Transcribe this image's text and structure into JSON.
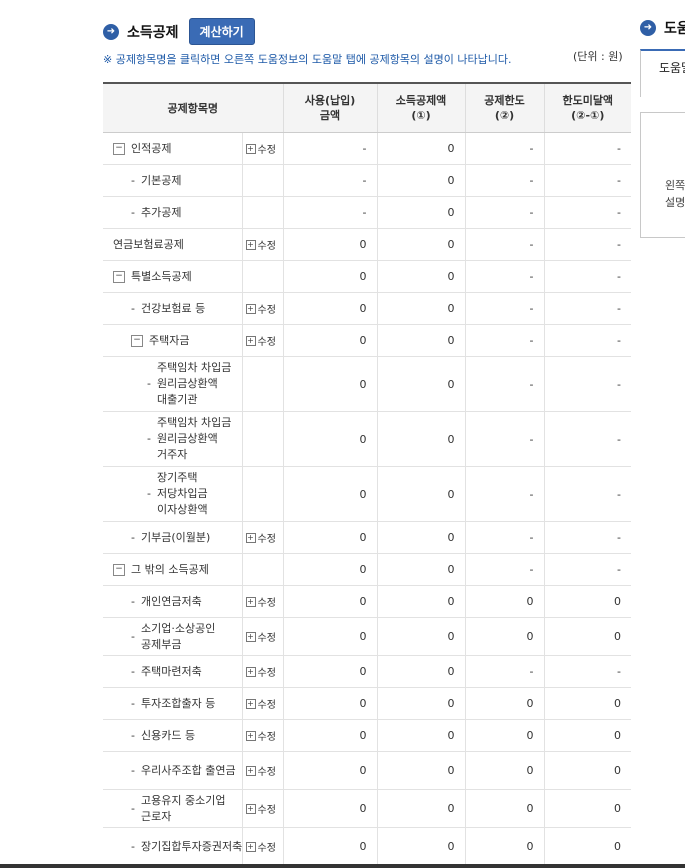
{
  "section": {
    "title": "소득공제",
    "calc_button": "계산하기"
  },
  "notice": "※ 공제항목명을 클릭하면 오른쪽 도움정보의 도움말 탭에 공제항목의 설명이 나타납니다.",
  "unit": "(단위 : 원)",
  "columns": [
    "공제항목명",
    "사용(납입)\n금액",
    "소득공제액\n(①)",
    "공제한도\n(②)",
    "한도미달액\n(②-①)"
  ],
  "edit_label": "수정",
  "rows": [
    {
      "name": "인적공제",
      "level": "lvl0",
      "toggle": "−",
      "edit": true,
      "amount": "-",
      "deduction": "0",
      "limit": "-",
      "shortfall": "-"
    },
    {
      "name": "기본공제",
      "level": "lvl1",
      "dash": "-",
      "edit": false,
      "amount": "-",
      "deduction": "0",
      "limit": "-",
      "shortfall": "-"
    },
    {
      "name": "추가공제",
      "level": "lvl1",
      "dash": "-",
      "edit": false,
      "amount": "-",
      "deduction": "0",
      "limit": "-",
      "shortfall": "-"
    },
    {
      "name": "연금보험료공제",
      "level": "lvl0plain",
      "edit": true,
      "amount": "0",
      "deduction": "0",
      "limit": "-",
      "shortfall": "-"
    },
    {
      "name": "특별소득공제",
      "level": "lvl0",
      "toggle": "−",
      "edit": false,
      "amount": "0",
      "deduction": "0",
      "limit": "-",
      "shortfall": "-"
    },
    {
      "name": "건강보험료 등",
      "level": "lvl1",
      "dash": "-",
      "edit": true,
      "amount": "0",
      "deduction": "0",
      "limit": "-",
      "shortfall": "-"
    },
    {
      "name": "주택자금",
      "level": "lvl1b",
      "toggle": "−",
      "edit": true,
      "amount": "0",
      "deduction": "0",
      "limit": "-",
      "shortfall": "-"
    },
    {
      "name": "주택임차 차입금 원리금상환액 대출기관",
      "level": "lvl2",
      "dash": "-",
      "edit": false,
      "tall": true,
      "amount": "0",
      "deduction": "0",
      "limit": "-",
      "shortfall": "-"
    },
    {
      "name": "주택임차 차입금 원리금상환액 거주자",
      "level": "lvl2",
      "dash": "-",
      "edit": false,
      "tall": true,
      "amount": "0",
      "deduction": "0",
      "limit": "-",
      "shortfall": "-"
    },
    {
      "name": "장기주택 저당차입금 이자상환액",
      "level": "lvl2",
      "dash": "-",
      "edit": false,
      "tall": true,
      "amount": "0",
      "deduction": "0",
      "limit": "-",
      "shortfall": "-"
    },
    {
      "name": "기부금(이월분)",
      "level": "lvl1",
      "dash": "-",
      "edit": true,
      "amount": "0",
      "deduction": "0",
      "limit": "-",
      "shortfall": "-"
    },
    {
      "name": "그 밖의 소득공제",
      "level": "lvl0",
      "toggle": "−",
      "edit": false,
      "amount": "0",
      "deduction": "0",
      "limit": "-",
      "shortfall": "-"
    },
    {
      "name": "개인연금저축",
      "level": "lvl1",
      "dash": "-",
      "edit": true,
      "amount": "0",
      "deduction": "0",
      "limit": "0",
      "shortfall": "0"
    },
    {
      "name": "소기업·소상공인 공제부금",
      "level": "lvl1",
      "dash": "-",
      "edit": true,
      "mid": true,
      "amount": "0",
      "deduction": "0",
      "limit": "0",
      "shortfall": "0"
    },
    {
      "name": "주택마련저축",
      "level": "lvl1",
      "dash": "-",
      "edit": true,
      "amount": "0",
      "deduction": "0",
      "limit": "-",
      "shortfall": "-"
    },
    {
      "name": "투자조합출자 등",
      "level": "lvl1",
      "dash": "-",
      "edit": true,
      "amount": "0",
      "deduction": "0",
      "limit": "0",
      "shortfall": "0"
    },
    {
      "name": "신용카드 등",
      "level": "lvl1",
      "dash": "-",
      "edit": true,
      "amount": "0",
      "deduction": "0",
      "limit": "0",
      "shortfall": "0"
    },
    {
      "name": "우리사주조합 출연금",
      "level": "lvl1",
      "dash": "-",
      "edit": true,
      "mid": true,
      "amount": "0",
      "deduction": "0",
      "limit": "0",
      "shortfall": "0"
    },
    {
      "name": "고용유지 중소기업 근로자",
      "level": "lvl1",
      "dash": "-",
      "edit": true,
      "mid": true,
      "amount": "0",
      "deduction": "0",
      "limit": "0",
      "shortfall": "0"
    },
    {
      "name": "장기집합투자증권저축",
      "level": "lvl1",
      "dash": "-",
      "edit": true,
      "mid": true,
      "amount": "0",
      "deduction": "0",
      "limit": "0",
      "shortfall": "0"
    }
  ],
  "help": {
    "title": "도움정보",
    "tab": "도움말",
    "lines": [
      "왼쪽",
      "설명"
    ]
  }
}
